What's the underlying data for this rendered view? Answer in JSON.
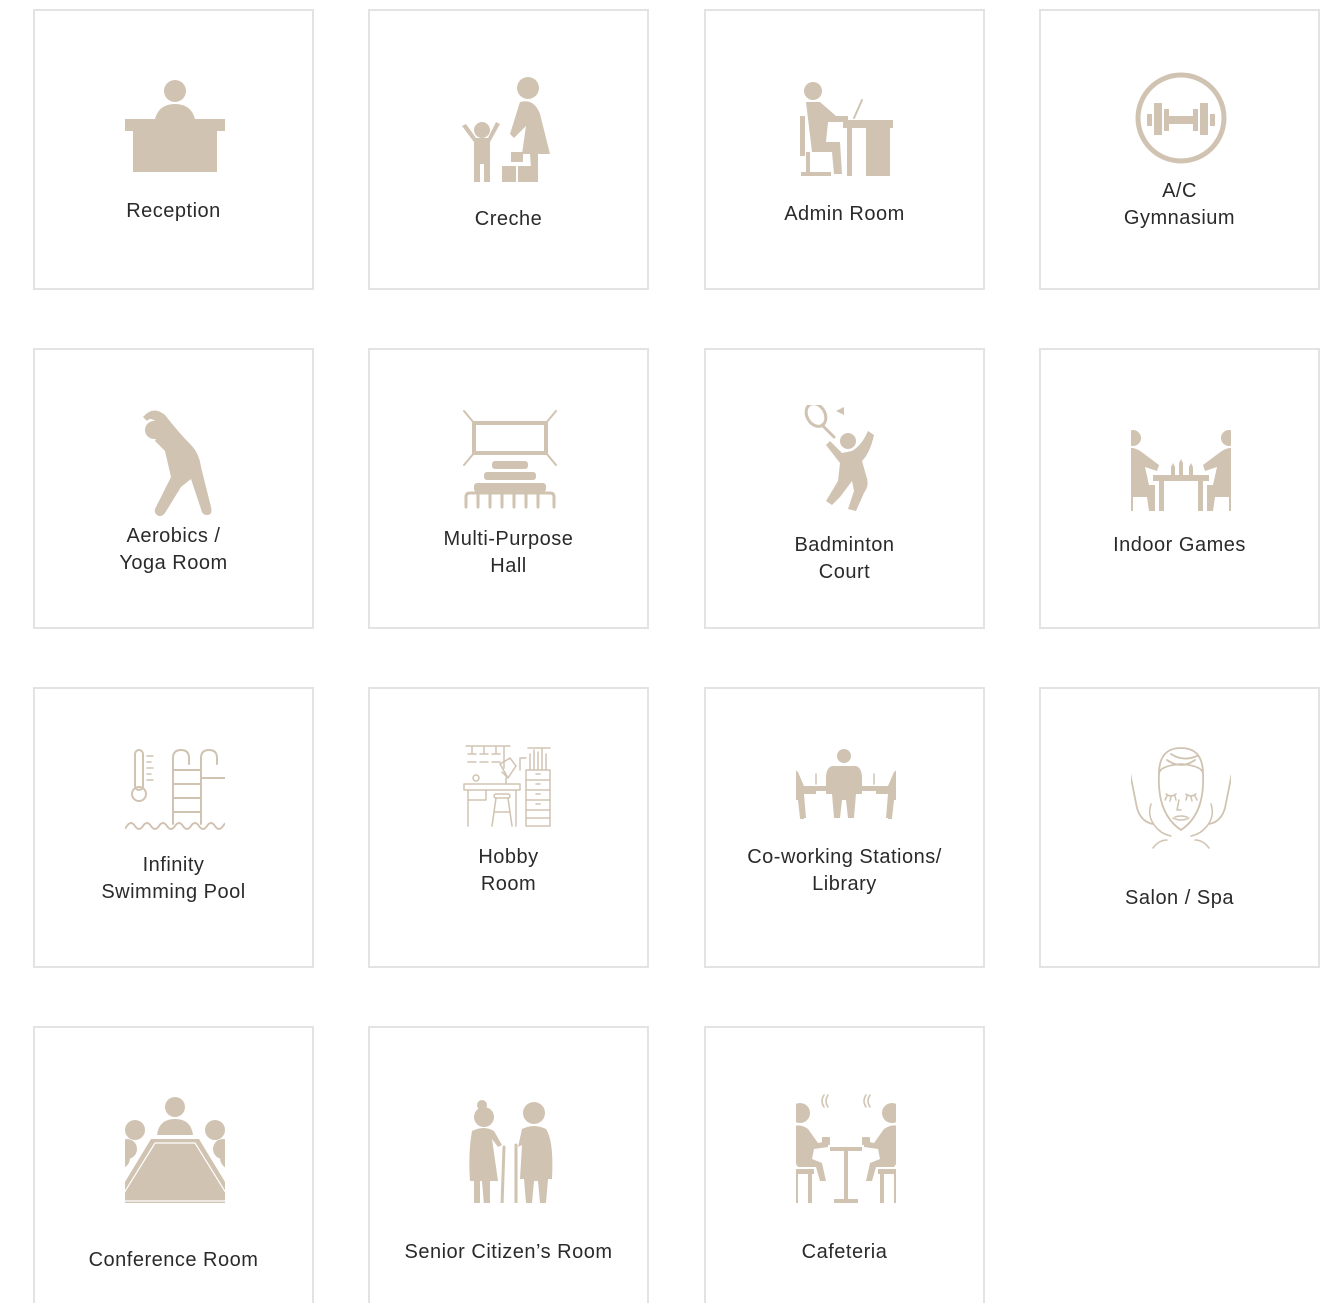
{
  "accent_color": "#d0c3b2",
  "amenities": [
    {
      "label": "Reception",
      "icon": "reception-desk-icon"
    },
    {
      "label": "Creche",
      "icon": "creche-child-play-icon"
    },
    {
      "label": "Admin Room",
      "icon": "admin-desk-icon"
    },
    {
      "label": "A/C\nGymnasium",
      "icon": "dumbbell-icon"
    },
    {
      "label": "Aerobics /\nYoga Room",
      "icon": "yoga-pose-icon"
    },
    {
      "label": "Multi-Purpose\nHall",
      "icon": "theatre-hall-icon"
    },
    {
      "label": "Badminton\nCourt",
      "icon": "badminton-player-icon"
    },
    {
      "label": "Indoor Games",
      "icon": "chess-players-icon"
    },
    {
      "label": "Infinity\nSwimming Pool",
      "icon": "pool-ladder-icon"
    },
    {
      "label": "Hobby\nRoom",
      "icon": "hobby-workbench-icon"
    },
    {
      "label": "Co-working Stations/\nLibrary",
      "icon": "coworking-people-icon"
    },
    {
      "label": "Salon / Spa",
      "icon": "spa-face-massage-icon"
    },
    {
      "label": "Conference Room",
      "icon": "conference-table-icon"
    },
    {
      "label": "Senior Citizen’s Room",
      "icon": "senior-couple-icon"
    },
    {
      "label": "Cafeteria",
      "icon": "cafe-table-icon"
    }
  ]
}
